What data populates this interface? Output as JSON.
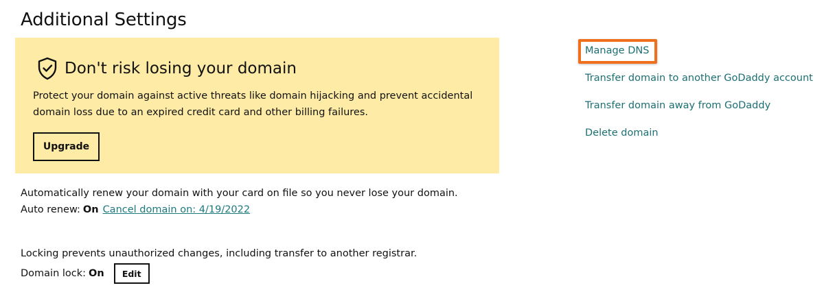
{
  "page": {
    "title": "Additional Settings"
  },
  "promo": {
    "icon": "shield-check-icon",
    "title": "Don't risk losing your domain",
    "body": "Protect your domain against active threats like domain hijacking and prevent accidental domain loss due to an expired credit card and other billing failures.",
    "button_label": "Upgrade",
    "background": "#fdeba6"
  },
  "auto_renew": {
    "description": "Automatically renew your domain with your card on file so you never lose your domain.",
    "label": "Auto renew:",
    "status": "On",
    "cancel_link": "Cancel domain on: 4/19/2022"
  },
  "domain_lock": {
    "description": "Locking prevents unauthorized changes, including transfer to another registrar.",
    "label": "Domain lock:",
    "status": "On",
    "edit_label": "Edit"
  },
  "side_links": [
    {
      "label": "Manage DNS",
      "highlighted": true
    },
    {
      "label": "Transfer domain to another GoDaddy account"
    },
    {
      "label": "Transfer domain away from GoDaddy"
    },
    {
      "label": "Delete domain"
    }
  ],
  "colors": {
    "link": "#1c6f73",
    "highlight": "#ef6f1c"
  }
}
